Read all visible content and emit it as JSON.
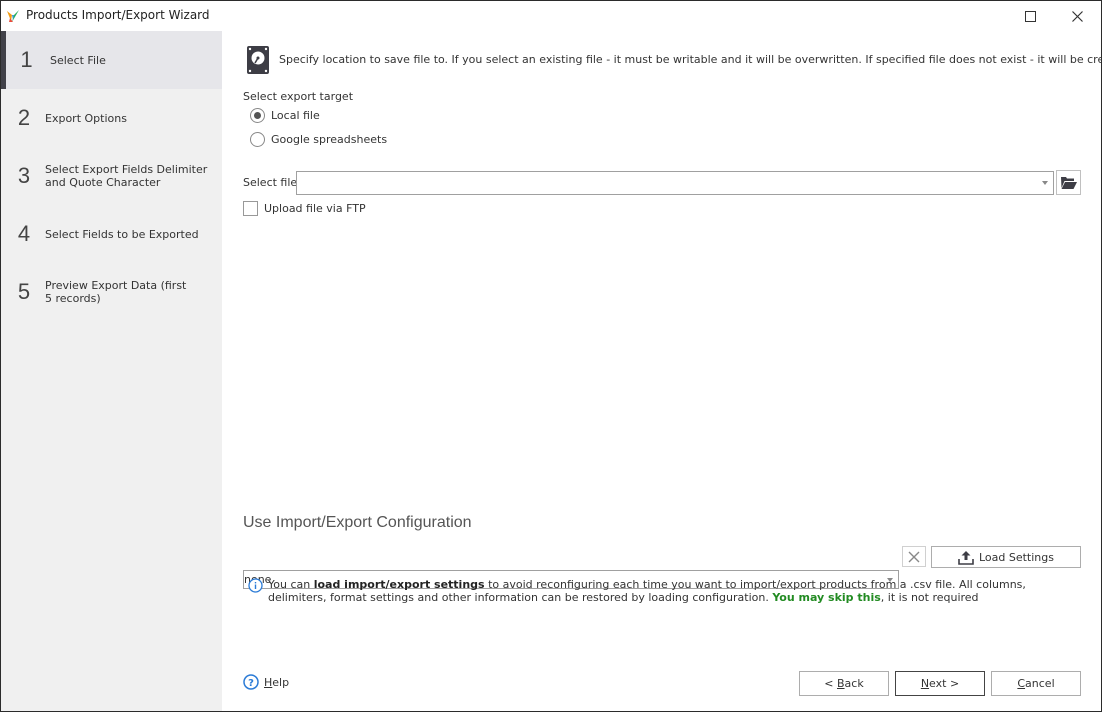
{
  "window": {
    "title": "Products Import/Export Wizard",
    "controls": {
      "maximize_icon": "maximize-icon",
      "close_icon": "close-icon"
    }
  },
  "sidebar": {
    "steps": [
      {
        "number": "1",
        "label": "Select File",
        "active": true
      },
      {
        "number": "2",
        "label": "Export Options",
        "active": false
      },
      {
        "number": "3",
        "label": "Select Export Fields Delimiter and Quote Character",
        "active": false
      },
      {
        "number": "4",
        "label": "Select Fields to be Exported",
        "active": false
      },
      {
        "number": "5",
        "label": "Preview Export Data (first 5 records)",
        "active": false
      }
    ]
  },
  "main": {
    "description": "Specify location to save file to. If you select an existing file - it must be writable and it will be overwritten. If specified file does not exist - it will be created.",
    "export_target": {
      "label": "Select export target",
      "options": [
        {
          "label": "Local file",
          "checked": true
        },
        {
          "label": "Google spreadsheets",
          "checked": false
        }
      ]
    },
    "select_file": {
      "label": "Select file",
      "value": ""
    },
    "ftp": {
      "label": "Upload file via FTP",
      "checked": false
    },
    "config": {
      "title": "Use Import/Export Configuration",
      "value": "none",
      "load_button": "Load Settings",
      "info": {
        "part1": "You can ",
        "bold": "load import/export settings",
        "part2": " to avoid reconfiguring each time you want to import/export products from a .csv file. All columns, delimiters, format settings and other information can be restored by loading configuration. ",
        "green": "You may skip this",
        "part3": ", it is not required"
      }
    }
  },
  "footer": {
    "help": {
      "first": "H",
      "rest": "elp"
    },
    "back": {
      "prefix": "< ",
      "first": "B",
      "rest": "ack"
    },
    "next": {
      "first": "N",
      "rest": "ext >"
    },
    "cancel": {
      "first": "C",
      "rest": "ancel"
    }
  },
  "colors": {
    "sidebar_bg": "#f0f0f0",
    "active_step_bg": "#e6e6ea",
    "active_step_bar": "#414149",
    "info_blue": "#2b7bd6",
    "skip_green": "#228b22"
  }
}
